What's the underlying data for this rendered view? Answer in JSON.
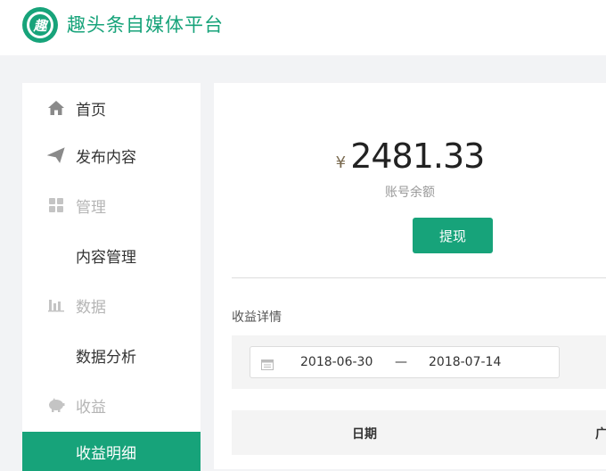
{
  "app": {
    "title": "趣头条自媒体平台",
    "logo_char": "趣"
  },
  "colors": {
    "brand": "#17a37a",
    "muted": "#b5b5b5"
  },
  "sidebar": {
    "items": [
      {
        "label": "首页",
        "icon": "home-icon"
      },
      {
        "label": "发布内容",
        "icon": "send-icon"
      },
      {
        "label": "管理",
        "icon": "grid-icon"
      },
      {
        "label": "内容管理"
      },
      {
        "label": "数据",
        "icon": "bar-chart-icon"
      },
      {
        "label": "数据分析"
      },
      {
        "label": "收益",
        "icon": "piggy-bank-icon"
      },
      {
        "label": "收益明细"
      }
    ]
  },
  "balance": {
    "currency": "¥",
    "amount": "2481.33",
    "label": "账号余额",
    "withdraw_label": "提现"
  },
  "earnings": {
    "section_title": "收益详情",
    "date_start": "2018-06-30",
    "date_separator": "—",
    "date_end": "2018-07-14",
    "columns": [
      "日期",
      "广"
    ]
  }
}
